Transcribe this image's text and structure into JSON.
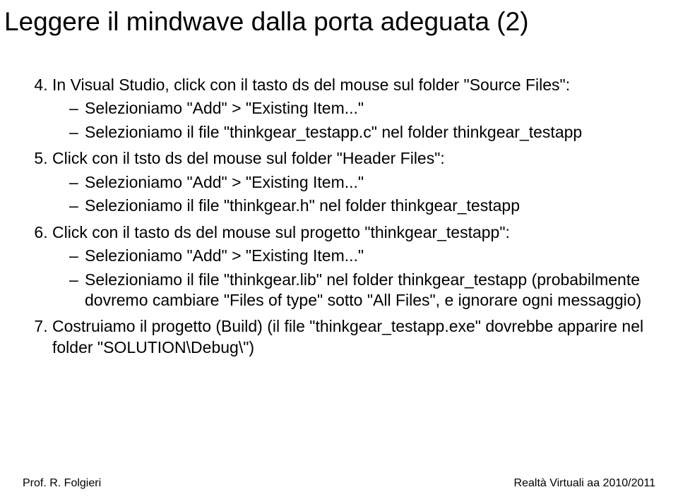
{
  "title": "Leggere il mindwave dalla porta adeguata (2)",
  "list_start": 4,
  "items": [
    {
      "text": "In Visual Studio, click con il tasto ds del mouse sul folder \"Source Files\":",
      "sub": [
        "Selezioniamo \"Add\" > \"Existing Item...\"",
        "Selezioniamo il file \"thinkgear_testapp.c\" nel folder thinkgear_testapp"
      ]
    },
    {
      "text": "Click con il tsto ds del mouse sul folder \"Header Files\":",
      "sub": [
        "Selezioniamo \"Add\" > \"Existing Item...\"",
        "Selezioniamo il file \"thinkgear.h\" nel folder thinkgear_testapp"
      ]
    },
    {
      "text": "Click con il tasto ds del mouse sul progetto \"thinkgear_testapp\":",
      "sub": [
        "Selezioniamo \"Add\" > \"Existing Item...\"",
        "Selezioniamo il file \"thinkgear.lib\" nel folder thinkgear_testapp (probabilmente dovremo cambiare \"Files of type\" sotto \"All Files\", e ignorare ogni messaggio)"
      ]
    },
    {
      "text": "Costruiamo il progetto (Build) (il file \"thinkgear_testapp.exe\" dovrebbe apparire nel folder \"SOLUTION\\Debug\\\")",
      "sub": []
    }
  ],
  "footer": {
    "left": "Prof. R. Folgieri",
    "right": "Realtà Virtuali aa 2010/2011"
  }
}
